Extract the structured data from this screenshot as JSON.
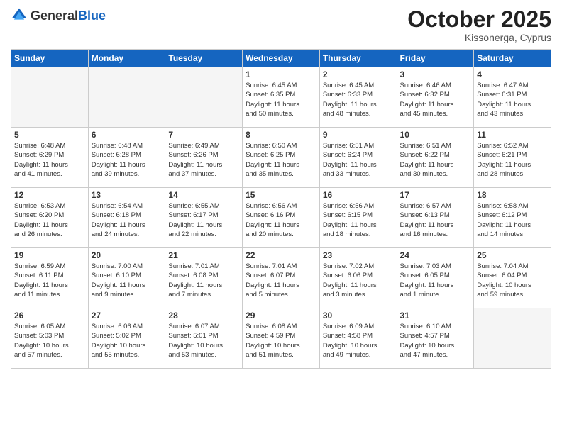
{
  "header": {
    "logo_general": "General",
    "logo_blue": "Blue",
    "month": "October 2025",
    "location": "Kissonerga, Cyprus"
  },
  "weekdays": [
    "Sunday",
    "Monday",
    "Tuesday",
    "Wednesday",
    "Thursday",
    "Friday",
    "Saturday"
  ],
  "weeks": [
    [
      {
        "day": "",
        "info": ""
      },
      {
        "day": "",
        "info": ""
      },
      {
        "day": "",
        "info": ""
      },
      {
        "day": "1",
        "info": "Sunrise: 6:45 AM\nSunset: 6:35 PM\nDaylight: 11 hours\nand 50 minutes."
      },
      {
        "day": "2",
        "info": "Sunrise: 6:45 AM\nSunset: 6:33 PM\nDaylight: 11 hours\nand 48 minutes."
      },
      {
        "day": "3",
        "info": "Sunrise: 6:46 AM\nSunset: 6:32 PM\nDaylight: 11 hours\nand 45 minutes."
      },
      {
        "day": "4",
        "info": "Sunrise: 6:47 AM\nSunset: 6:31 PM\nDaylight: 11 hours\nand 43 minutes."
      }
    ],
    [
      {
        "day": "5",
        "info": "Sunrise: 6:48 AM\nSunset: 6:29 PM\nDaylight: 11 hours\nand 41 minutes."
      },
      {
        "day": "6",
        "info": "Sunrise: 6:48 AM\nSunset: 6:28 PM\nDaylight: 11 hours\nand 39 minutes."
      },
      {
        "day": "7",
        "info": "Sunrise: 6:49 AM\nSunset: 6:26 PM\nDaylight: 11 hours\nand 37 minutes."
      },
      {
        "day": "8",
        "info": "Sunrise: 6:50 AM\nSunset: 6:25 PM\nDaylight: 11 hours\nand 35 minutes."
      },
      {
        "day": "9",
        "info": "Sunrise: 6:51 AM\nSunset: 6:24 PM\nDaylight: 11 hours\nand 33 minutes."
      },
      {
        "day": "10",
        "info": "Sunrise: 6:51 AM\nSunset: 6:22 PM\nDaylight: 11 hours\nand 30 minutes."
      },
      {
        "day": "11",
        "info": "Sunrise: 6:52 AM\nSunset: 6:21 PM\nDaylight: 11 hours\nand 28 minutes."
      }
    ],
    [
      {
        "day": "12",
        "info": "Sunrise: 6:53 AM\nSunset: 6:20 PM\nDaylight: 11 hours\nand 26 minutes."
      },
      {
        "day": "13",
        "info": "Sunrise: 6:54 AM\nSunset: 6:18 PM\nDaylight: 11 hours\nand 24 minutes."
      },
      {
        "day": "14",
        "info": "Sunrise: 6:55 AM\nSunset: 6:17 PM\nDaylight: 11 hours\nand 22 minutes."
      },
      {
        "day": "15",
        "info": "Sunrise: 6:56 AM\nSunset: 6:16 PM\nDaylight: 11 hours\nand 20 minutes."
      },
      {
        "day": "16",
        "info": "Sunrise: 6:56 AM\nSunset: 6:15 PM\nDaylight: 11 hours\nand 18 minutes."
      },
      {
        "day": "17",
        "info": "Sunrise: 6:57 AM\nSunset: 6:13 PM\nDaylight: 11 hours\nand 16 minutes."
      },
      {
        "day": "18",
        "info": "Sunrise: 6:58 AM\nSunset: 6:12 PM\nDaylight: 11 hours\nand 14 minutes."
      }
    ],
    [
      {
        "day": "19",
        "info": "Sunrise: 6:59 AM\nSunset: 6:11 PM\nDaylight: 11 hours\nand 11 minutes."
      },
      {
        "day": "20",
        "info": "Sunrise: 7:00 AM\nSunset: 6:10 PM\nDaylight: 11 hours\nand 9 minutes."
      },
      {
        "day": "21",
        "info": "Sunrise: 7:01 AM\nSunset: 6:08 PM\nDaylight: 11 hours\nand 7 minutes."
      },
      {
        "day": "22",
        "info": "Sunrise: 7:01 AM\nSunset: 6:07 PM\nDaylight: 11 hours\nand 5 minutes."
      },
      {
        "day": "23",
        "info": "Sunrise: 7:02 AM\nSunset: 6:06 PM\nDaylight: 11 hours\nand 3 minutes."
      },
      {
        "day": "24",
        "info": "Sunrise: 7:03 AM\nSunset: 6:05 PM\nDaylight: 11 hours\nand 1 minute."
      },
      {
        "day": "25",
        "info": "Sunrise: 7:04 AM\nSunset: 6:04 PM\nDaylight: 10 hours\nand 59 minutes."
      }
    ],
    [
      {
        "day": "26",
        "info": "Sunrise: 6:05 AM\nSunset: 5:03 PM\nDaylight: 10 hours\nand 57 minutes."
      },
      {
        "day": "27",
        "info": "Sunrise: 6:06 AM\nSunset: 5:02 PM\nDaylight: 10 hours\nand 55 minutes."
      },
      {
        "day": "28",
        "info": "Sunrise: 6:07 AM\nSunset: 5:01 PM\nDaylight: 10 hours\nand 53 minutes."
      },
      {
        "day": "29",
        "info": "Sunrise: 6:08 AM\nSunset: 4:59 PM\nDaylight: 10 hours\nand 51 minutes."
      },
      {
        "day": "30",
        "info": "Sunrise: 6:09 AM\nSunset: 4:58 PM\nDaylight: 10 hours\nand 49 minutes."
      },
      {
        "day": "31",
        "info": "Sunrise: 6:10 AM\nSunset: 4:57 PM\nDaylight: 10 hours\nand 47 minutes."
      },
      {
        "day": "",
        "info": ""
      }
    ]
  ]
}
